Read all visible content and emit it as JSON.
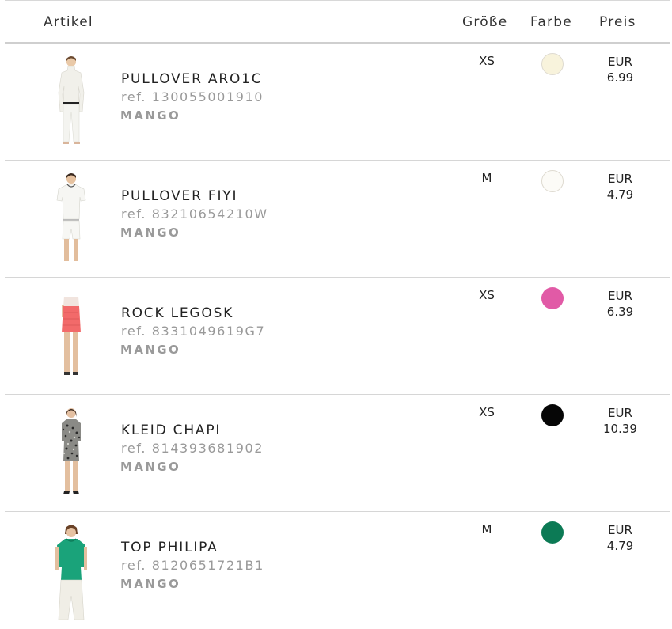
{
  "header": {
    "article": "Artikel",
    "size": "Größe",
    "color": "Farbe",
    "price": "Preis"
  },
  "items": [
    {
      "name": "PULLOVER ARO1C",
      "ref": "ref. 130055001910",
      "brand": "MANGO",
      "size": "XS",
      "color": "#f8f3dc",
      "currency": "EUR",
      "price": "6.99"
    },
    {
      "name": "PULLOVER FIYI",
      "ref": "ref. 83210654210W",
      "brand": "MANGO",
      "size": "M",
      "color": "#fcfbf7",
      "currency": "EUR",
      "price": "4.79"
    },
    {
      "name": "ROCK LEGOSK",
      "ref": "ref. 8331049619G7",
      "brand": "MANGO",
      "size": "XS",
      "color": "#e15aa6",
      "currency": "EUR",
      "price": "6.39"
    },
    {
      "name": "KLEID CHAPI",
      "ref": "ref. 814393681902",
      "brand": "MANGO",
      "size": "XS",
      "color": "#060606",
      "currency": "EUR",
      "price": "10.39"
    },
    {
      "name": "TOP PHILIPA",
      "ref": "ref. 8120651721B1",
      "brand": "MANGO",
      "size": "M",
      "color": "#0c7a55",
      "currency": "EUR",
      "price": "4.79"
    }
  ]
}
